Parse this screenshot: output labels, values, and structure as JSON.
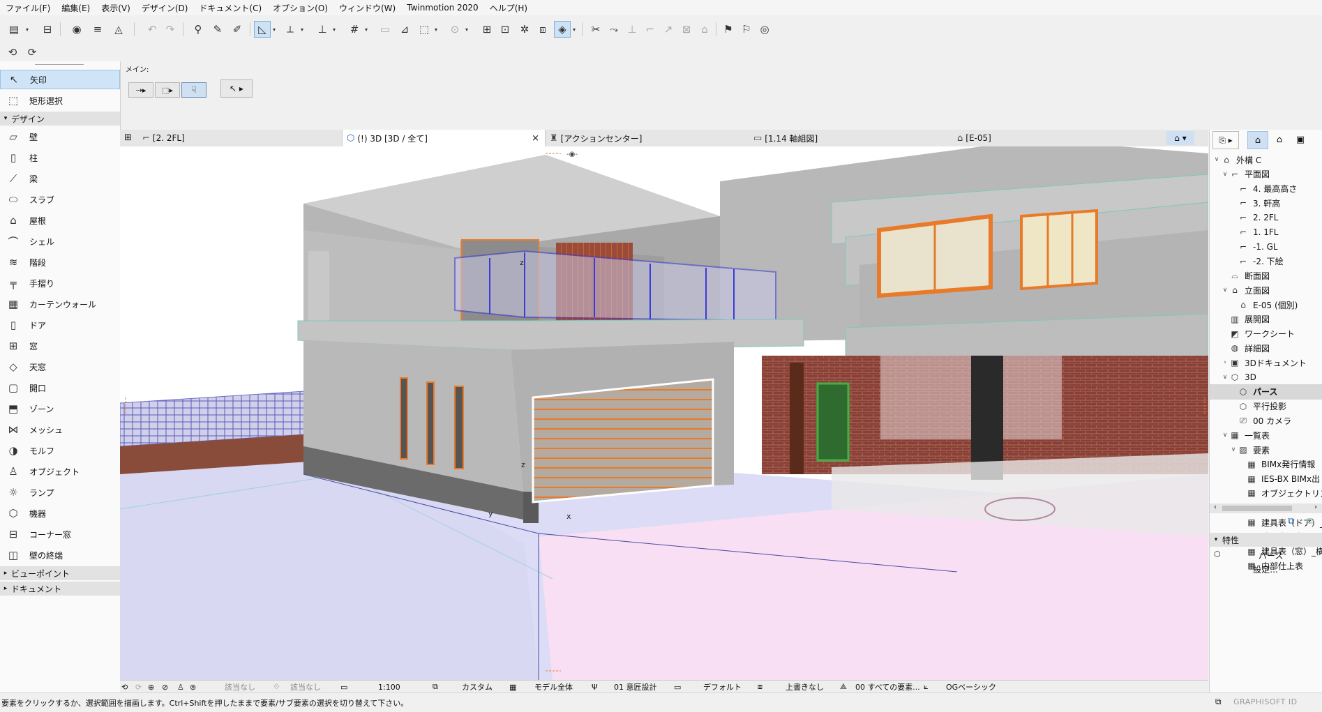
{
  "menu": [
    "ファイル(F)",
    "編集(E)",
    "表示(V)",
    "デザイン(D)",
    "ドキュメント(C)",
    "オプション(O)",
    "ウィンドウ(W)",
    "Twinmotion 2020",
    "ヘルプ(H)"
  ],
  "infobox": {
    "label": "メイン:"
  },
  "toolbox": {
    "top_items": [
      {
        "label": "矢印",
        "icon": "arrow-icon",
        "glyph": "↖"
      },
      {
        "label": "矩形選択",
        "icon": "marquee-icon",
        "glyph": "⬚"
      }
    ],
    "design_header": "デザイン",
    "design_items": [
      {
        "label": "壁",
        "icon": "wall-icon",
        "glyph": "▱"
      },
      {
        "label": "柱",
        "icon": "column-icon",
        "glyph": "▯"
      },
      {
        "label": "梁",
        "icon": "beam-icon",
        "glyph": "⟋"
      },
      {
        "label": "スラブ",
        "icon": "slab-icon",
        "glyph": "⬭"
      },
      {
        "label": "屋根",
        "icon": "roof-icon",
        "glyph": "⌂"
      },
      {
        "label": "シェル",
        "icon": "shell-icon",
        "glyph": "⌒"
      },
      {
        "label": "階段",
        "icon": "stair-icon",
        "glyph": "≋"
      },
      {
        "label": "手摺り",
        "icon": "railing-icon",
        "glyph": "╤"
      },
      {
        "label": "カーテンウォール",
        "icon": "curtain-wall-icon",
        "glyph": "▦"
      },
      {
        "label": "ドア",
        "icon": "door-icon",
        "glyph": "▯"
      },
      {
        "label": "窓",
        "icon": "window-icon",
        "glyph": "⊞"
      },
      {
        "label": "天窓",
        "icon": "skylight-icon",
        "glyph": "◇"
      },
      {
        "label": "開口",
        "icon": "opening-icon",
        "glyph": "▢"
      },
      {
        "label": "ゾーン",
        "icon": "zone-icon",
        "glyph": "⬒"
      },
      {
        "label": "メッシュ",
        "icon": "mesh-icon",
        "glyph": "⋈"
      },
      {
        "label": "モルフ",
        "icon": "morph-icon",
        "glyph": "◑"
      },
      {
        "label": "オブジェクト",
        "icon": "object-icon",
        "glyph": "♙"
      },
      {
        "label": "ランプ",
        "icon": "lamp-icon",
        "glyph": "☼"
      },
      {
        "label": "機器",
        "icon": "equipment-icon",
        "glyph": "⬡"
      },
      {
        "label": "コーナー窓",
        "icon": "corner-window-icon",
        "glyph": "⊟"
      },
      {
        "label": "壁の終端",
        "icon": "wall-end-icon",
        "glyph": "◫"
      }
    ],
    "viewpoint_header": "ビューポイント",
    "document_header": "ドキュメント"
  },
  "tabs": [
    {
      "label": "[2. 2FL]",
      "icon": "floor-plan-icon",
      "glyph": "⌐"
    },
    {
      "label": "(!) 3D [3D / 全て]",
      "icon": "3d-window-icon",
      "glyph": "⬡",
      "active": true,
      "close": "×"
    },
    {
      "label": "[アクションセンター]",
      "icon": "action-center-icon",
      "glyph": "♜"
    },
    {
      "label": "[1.14 軸組図]",
      "icon": "worksheet-icon",
      "glyph": "▭"
    },
    {
      "label": "[E-05]",
      "icon": "elevation-icon",
      "glyph": "⌂"
    }
  ],
  "navigator": {
    "items": [
      {
        "label": "外構  C",
        "level": 0,
        "chev": "∨",
        "icon": "project-icon",
        "glyph": "⌂"
      },
      {
        "label": "平面図",
        "level": 1,
        "chev": "∨",
        "icon": "floor-plans-icon",
        "glyph": "⌐"
      },
      {
        "label": "4. 最高高さ",
        "level": 2,
        "chev": "",
        "icon": "story-icon",
        "glyph": "⌐"
      },
      {
        "label": "3. 軒高",
        "level": 2,
        "chev": "",
        "icon": "story-icon",
        "glyph": "⌐"
      },
      {
        "label": "2. 2FL",
        "level": 2,
        "chev": "",
        "icon": "story-icon",
        "glyph": "⌐"
      },
      {
        "label": "1. 1FL",
        "level": 2,
        "chev": "",
        "icon": "story-icon",
        "glyph": "⌐"
      },
      {
        "label": "-1. GL",
        "level": 2,
        "chev": "",
        "icon": "story-icon",
        "glyph": "⌐"
      },
      {
        "label": "-2. 下絵",
        "level": 2,
        "chev": "",
        "icon": "story-icon",
        "glyph": "⌐"
      },
      {
        "label": "断面図",
        "level": 1,
        "chev": "",
        "icon": "section-icon",
        "glyph": "⌓"
      },
      {
        "label": "立面図",
        "level": 1,
        "chev": "∨",
        "icon": "elevation-icon",
        "glyph": "⌂"
      },
      {
        "label": "E-05 (個別)",
        "level": 2,
        "chev": "",
        "icon": "elevation-icon",
        "glyph": "⌂"
      },
      {
        "label": "展開図",
        "level": 1,
        "chev": "",
        "icon": "interior-elevation-icon",
        "glyph": "▥"
      },
      {
        "label": "ワークシート",
        "level": 1,
        "chev": "",
        "icon": "worksheet-icon",
        "glyph": "◩"
      },
      {
        "label": "詳細図",
        "level": 1,
        "chev": "",
        "icon": "detail-icon",
        "glyph": "◍"
      },
      {
        "label": "3Dドキュメント",
        "level": 1,
        "chev": "›",
        "icon": "3d-document-icon",
        "glyph": "▣"
      },
      {
        "label": "3D",
        "level": 1,
        "chev": "∨",
        "icon": "3d-icon",
        "glyph": "⬡"
      },
      {
        "label": "パース",
        "level": 2,
        "chev": "",
        "icon": "perspective-icon",
        "glyph": "⬡",
        "selected": true
      },
      {
        "label": "平行投影",
        "level": 2,
        "chev": "",
        "icon": "axonometric-icon",
        "glyph": "⬡"
      },
      {
        "label": "00 カメラ",
        "level": 2,
        "chev": "",
        "icon": "camera-icon",
        "glyph": "⎚"
      },
      {
        "label": "一覧表",
        "level": 1,
        "chev": "∨",
        "icon": "schedule-icon",
        "glyph": "▦"
      },
      {
        "label": "要素",
        "level": 2,
        "chev": "∨",
        "icon": "elements-icon",
        "glyph": "▨"
      },
      {
        "label": "BIMx発行情報",
        "level": 3,
        "chev": "",
        "icon": "table-icon",
        "glyph": "▦"
      },
      {
        "label": "IES-BX BIMx出",
        "level": 3,
        "chev": "",
        "icon": "table-icon",
        "glyph": "▦"
      },
      {
        "label": "オブジェクトリスト",
        "level": 3,
        "chev": "",
        "icon": "table-icon",
        "glyph": "▦"
      },
      {
        "label": "建具表（ドア）",
        "level": 3,
        "chev": "",
        "icon": "table-icon",
        "glyph": "▦"
      },
      {
        "label": "建具表（ドア）_",
        "level": 3,
        "chev": "",
        "icon": "table-icon",
        "glyph": "▦"
      },
      {
        "label": "建具表（窓）",
        "level": 3,
        "chev": "",
        "icon": "table-icon",
        "glyph": "▦"
      },
      {
        "label": "建具表（窓）_横",
        "level": 3,
        "chev": "",
        "icon": "table-icon",
        "glyph": "▦"
      },
      {
        "label": "内部仕上表",
        "level": 3,
        "chev": "",
        "icon": "table-icon",
        "glyph": "▦"
      }
    ],
    "properties_header": "特性",
    "properties_value": "パース",
    "settings_button": "設定..."
  },
  "statusbar": {
    "none1": "該当なし",
    "none2": "該当なし",
    "scale": "1:100",
    "layer": "カスタム",
    "model": "モデル全体",
    "pen": "01 意匠設計",
    "override": "デフォルト",
    "renovation": "上書きなし",
    "filter": "00 すべての要素...",
    "surface": "OGベーシック"
  },
  "hint": "要素をクリックするか、選択範囲を描画します。Ctrl+Shiftを押したままで要素/サブ要素の選択を切り替えて下さい。",
  "brand": "GRAPHISOFT ID",
  "colors": {
    "accent": "#cfe4f7",
    "selection_blue": "#3b3bd6",
    "window_orange": "#e87a2a"
  }
}
